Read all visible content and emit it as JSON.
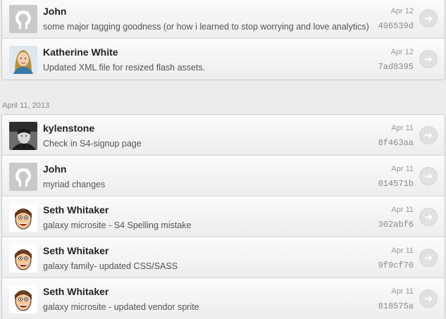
{
  "groups": [
    {
      "commits": [
        {
          "author": "John",
          "message": "some major tagging goodness (or how i learned to stop worrying and love analytics)",
          "date": "Apr 12",
          "sha": "496539d",
          "avatar": "github-default-avatar"
        },
        {
          "author": "Katherine White",
          "message": "Updated XML file for resized flash assets.",
          "date": "Apr 12",
          "sha": "7ad8395",
          "avatar": "photo-avatar-katherine"
        }
      ]
    },
    {
      "heading": "April 11, 2013",
      "commits": [
        {
          "author": "kylenstone",
          "message": "Check in S4-signup page",
          "date": "Apr 11",
          "sha": "8f463aa",
          "avatar": "photo-avatar-kylenstone"
        },
        {
          "author": "John",
          "message": "myriad changes",
          "date": "Apr 11",
          "sha": "014571b",
          "avatar": "github-default-avatar"
        },
        {
          "author": "Seth Whitaker",
          "message": "galaxy microsite - S4 Spelling mistake",
          "date": "Apr 11",
          "sha": "302abf6",
          "avatar": "cartoon-avatar-seth"
        },
        {
          "author": "Seth Whitaker",
          "message": "galaxy family- updated CSS/SASS",
          "date": "Apr 11",
          "sha": "9f9cf70",
          "avatar": "cartoon-avatar-seth"
        },
        {
          "author": "Seth Whitaker",
          "message": "galaxy microsite - updated vendor sprite",
          "date": "Apr 11",
          "sha": "818575a",
          "avatar": "cartoon-avatar-seth"
        }
      ]
    }
  ],
  "icons": {
    "go_button": "arrow-right-icon"
  },
  "colors": {
    "background": "#ececec",
    "row_top": "#fbfbfb",
    "row_bottom": "#ededed",
    "author": "#222222",
    "sha": "#8a8a8a"
  }
}
